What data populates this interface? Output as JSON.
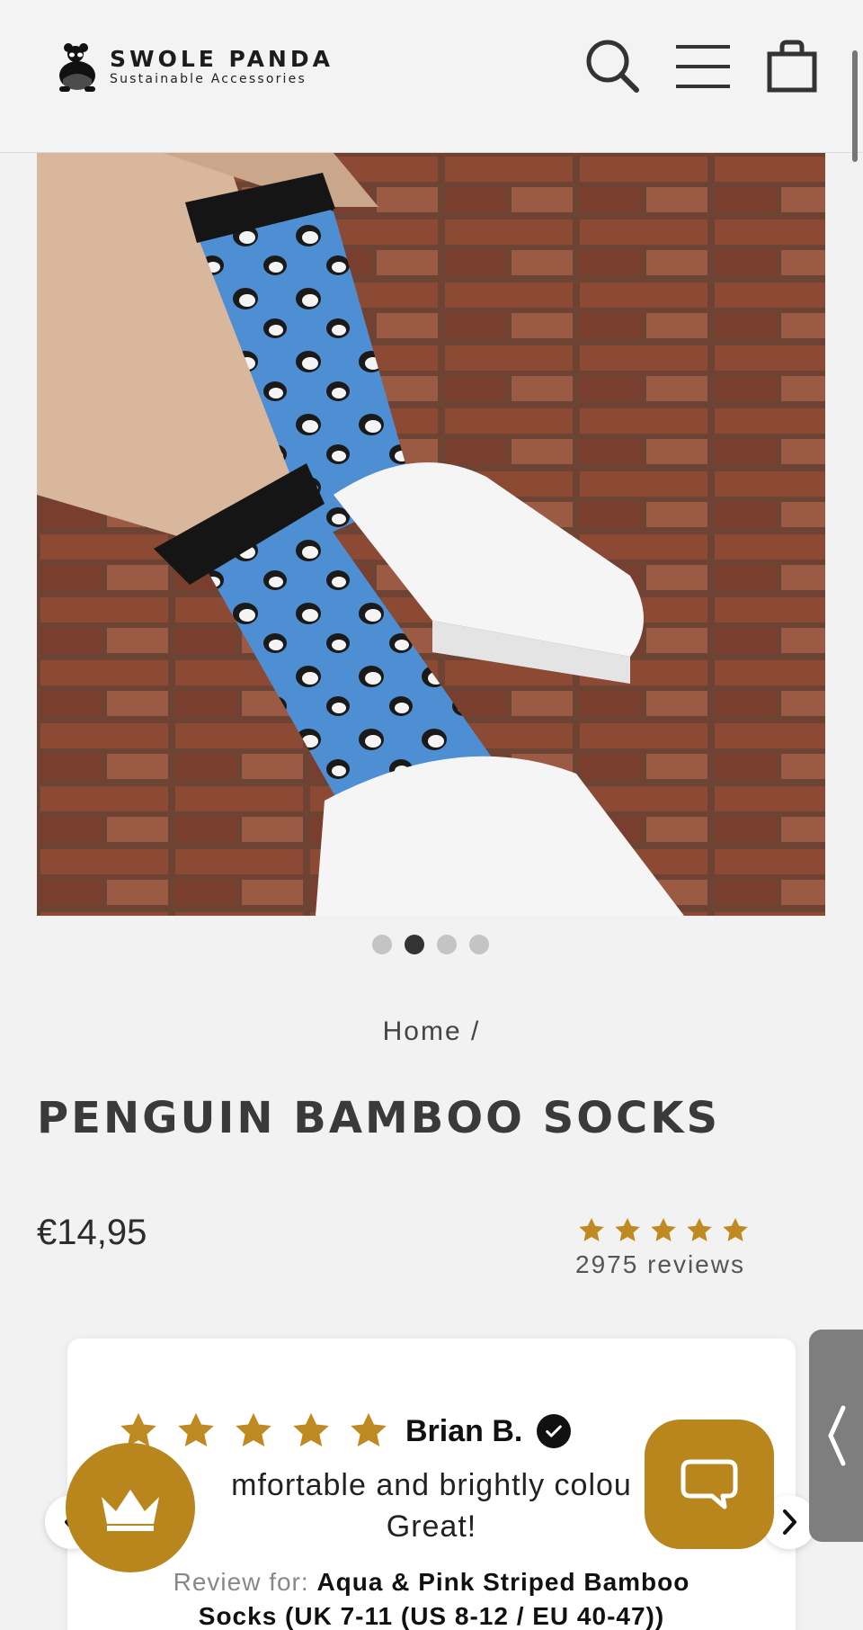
{
  "header": {
    "brand_name": "SWOLE PANDA",
    "brand_tagline": "Sustainable Accessories",
    "icons": [
      "search-icon",
      "menu-icon",
      "cart-icon"
    ]
  },
  "gallery": {
    "image_alt": "Penguin bamboo socks worn with white sneakers on brick steps",
    "slide_count": 4,
    "active_slide": 2
  },
  "breadcrumb": {
    "home": "Home",
    "separator": "/"
  },
  "product": {
    "title": "PENGUIN BAMBOO SOCKS",
    "price": "€14,95",
    "rating_stars": 5,
    "review_count": "2975 reviews"
  },
  "review": {
    "stars": 5,
    "author": "Brian B.",
    "body_line1": "mfortable and brightly colou",
    "body_line2": "Great!",
    "for_label": "Review for:",
    "for_product_line1": "Aqua & Pink Striped Bamboo",
    "for_product_line2": "Socks (UK 7-11 (US 8-12 / EU 40-47))"
  },
  "colors": {
    "accent_gold": "#b8861c",
    "star_gold": "#c08a22",
    "text_dark": "#333333"
  }
}
